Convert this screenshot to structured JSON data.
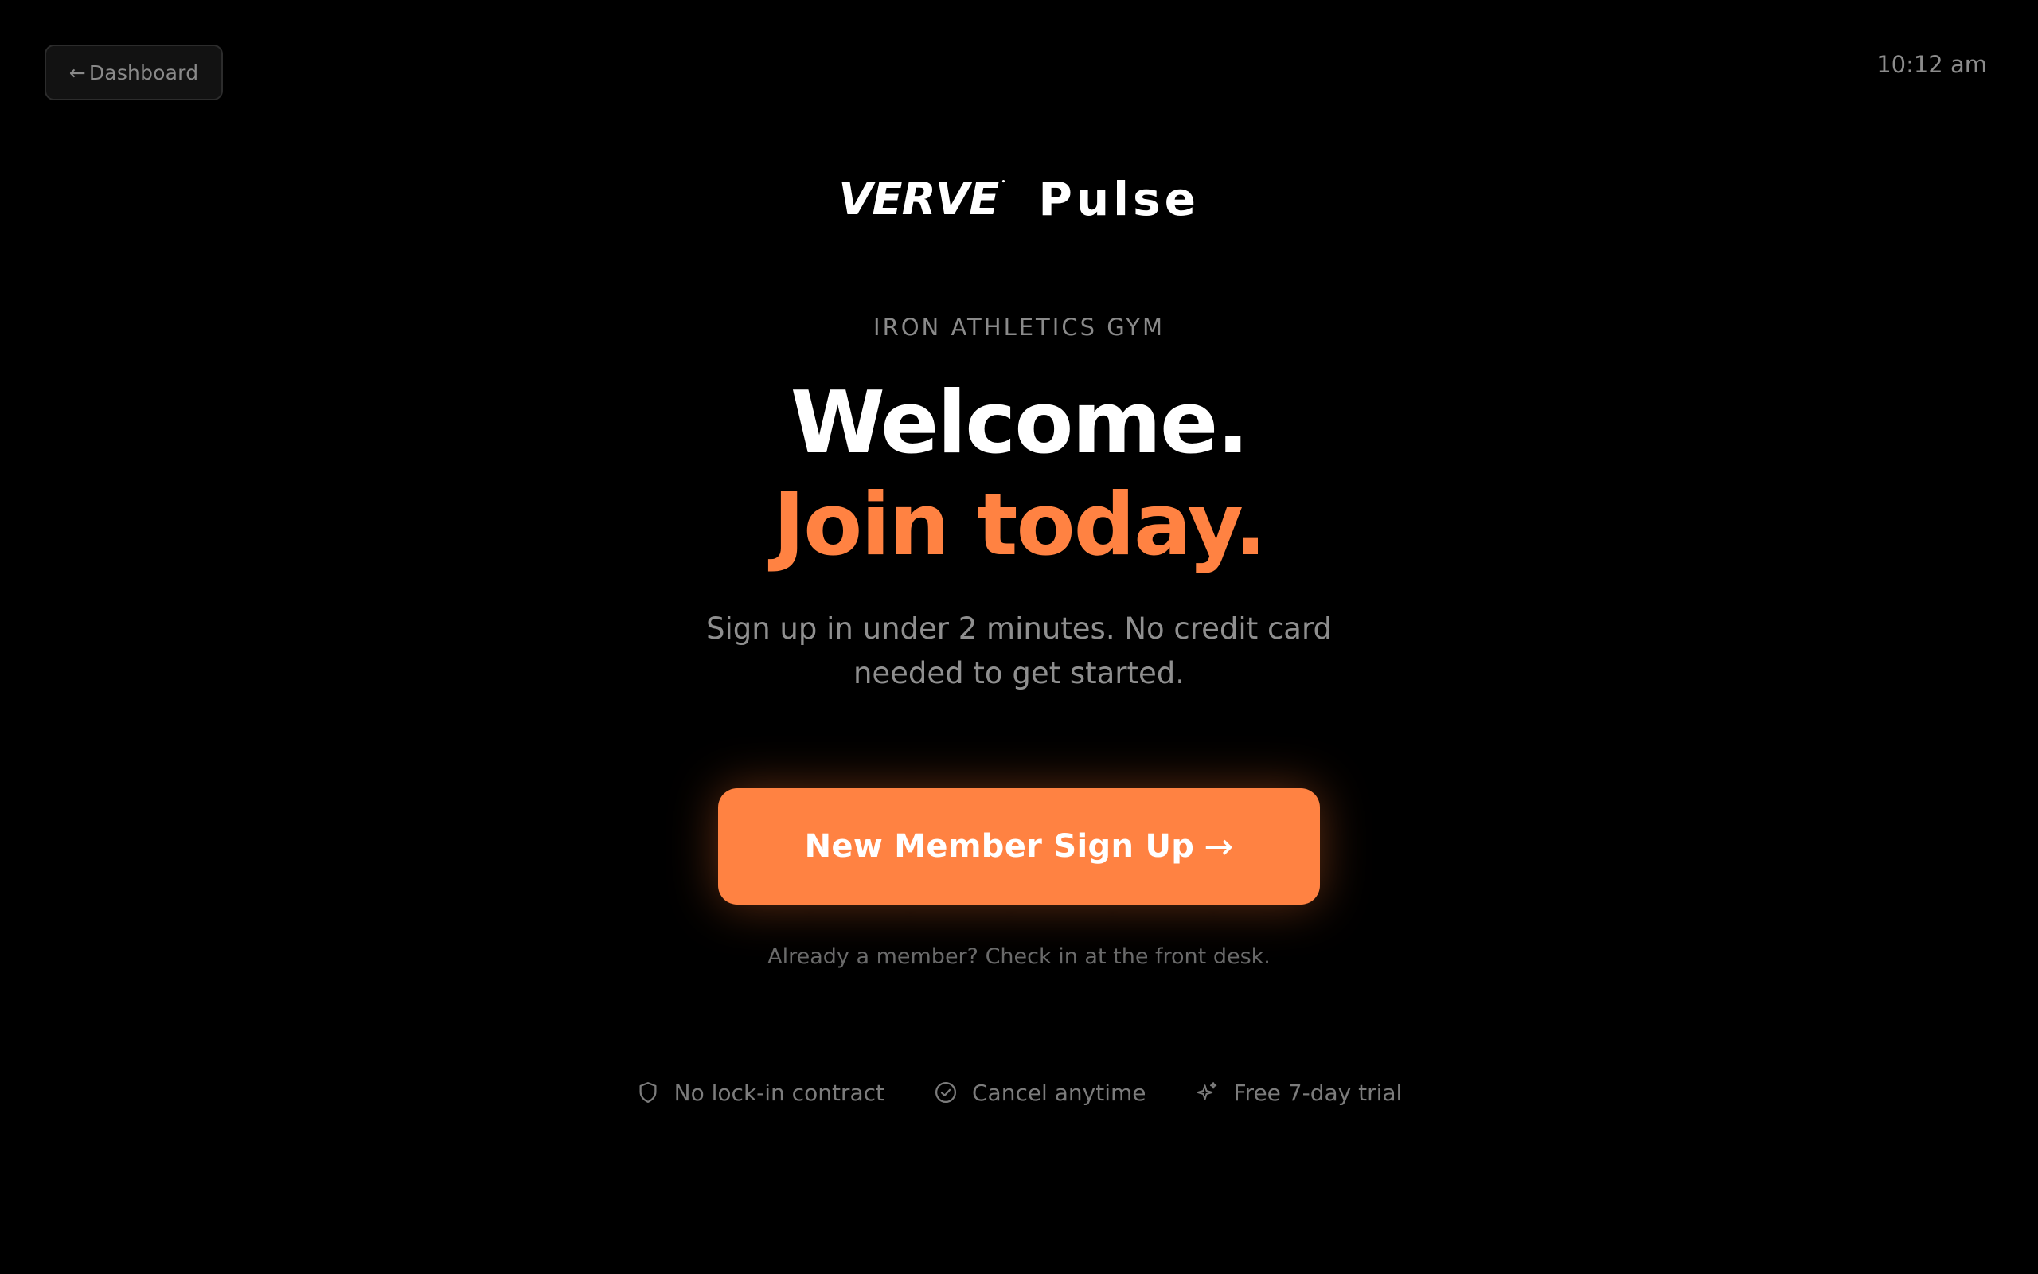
{
  "header": {
    "back_arrow": "←",
    "back_label": "Dashboard",
    "clock": "10:12 am"
  },
  "brand": {
    "logo_text": "VERVE",
    "logo_mark": "•",
    "product": "Pulse"
  },
  "hero": {
    "gym_name": "IRON ATHLETICS GYM",
    "headline_line1": "Welcome.",
    "headline_line2": "Join today.",
    "subtext": "Sign up in under 2 minutes. No credit card needed to get started."
  },
  "cta": {
    "label": "New Member Sign Up",
    "arrow": "→"
  },
  "member_note": "Already a member? Check in at the front desk.",
  "features": [
    {
      "icon": "shield-icon",
      "label": "No lock-in contract"
    },
    {
      "icon": "check-circle-icon",
      "label": "Cancel anytime"
    },
    {
      "icon": "sparkle-icon",
      "label": "Free 7-day trial"
    }
  ],
  "colors": {
    "background": "#000000",
    "accent": "#ff8242",
    "muted_text": "#8f8f8f"
  }
}
